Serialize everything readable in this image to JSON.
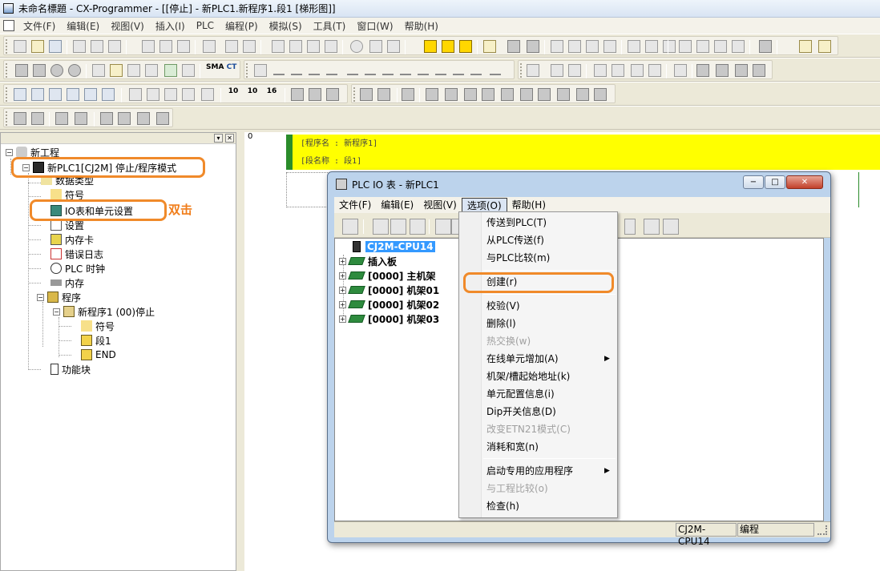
{
  "app": {
    "title": "未命名標題 - CX-Programmer - [[停止] - 新PLC1.新程序1.段1 [梯形图]]",
    "menu": [
      "文件(F)",
      "编辑(E)",
      "视图(V)",
      "插入(I)",
      "PLC",
      "编程(P)",
      "模拟(S)",
      "工具(T)",
      "窗口(W)",
      "帮助(H)"
    ]
  },
  "toolbar": {
    "row4_num_labels": [
      "10",
      "10",
      "16"
    ],
    "io_button": "I/O",
    "sma_label": "SMA",
    "ct_label": "CT"
  },
  "tree": {
    "root": "新工程",
    "plc": "新PLC1[CJ2M] 停止/程序模式",
    "datatype": "数据类型",
    "symbols": "符号",
    "io_table": "IO表和单元设置",
    "settings": "设置",
    "memcard": "内存卡",
    "errorlog": "错误日志",
    "clock": "PLC 时钟",
    "memory": "内存",
    "programs": "程序",
    "program1": "新程序1 (00)停止",
    "p_symbols": "符号",
    "p_section1": "段1",
    "p_end": "END",
    "function_blocks": "功能块"
  },
  "annotation": {
    "double_click": "双击"
  },
  "ladder": {
    "rung_number": "0",
    "program_name_line": "[程序名 : 新程序1]",
    "section_name_line": "[段名称 : 段1]"
  },
  "io_window": {
    "title": "PLC IO 表 - 新PLC1",
    "menu": [
      "文件(F)",
      "编辑(E)",
      "视图(V)",
      "选项(O)",
      "帮助(H)"
    ],
    "active_menu_index": 3,
    "tree": {
      "cpu": "CJ2M-CPU14",
      "items": [
        "插入板",
        "[0000] 主机架",
        "[0000] 机架01",
        "[0000] 机架02",
        "[0000] 机架03"
      ]
    },
    "status": {
      "cpu": "CJ2M-CPU14",
      "mode": "编程"
    },
    "options_menu": [
      {
        "label": "传送到PLC(T)",
        "enabled": true
      },
      {
        "label": "从PLC传送(f)",
        "enabled": true
      },
      {
        "label": "与PLC比较(m)",
        "enabled": true
      },
      {
        "label": "创建(r)",
        "enabled": true,
        "highlighted": true
      },
      {
        "label": "校验(V)",
        "enabled": true
      },
      {
        "label": "删除(l)",
        "enabled": true
      },
      {
        "label": "热交换(w)",
        "enabled": false
      },
      {
        "label": "在线单元增加(A)",
        "enabled": true,
        "submenu": true
      },
      {
        "label": "机架/槽起始地址(k)",
        "enabled": true
      },
      {
        "label": "单元配置信息(i)",
        "enabled": true
      },
      {
        "label": "Dip开关信息(D)",
        "enabled": true
      },
      {
        "label": "改变ETN21模式(C)",
        "enabled": false
      },
      {
        "label": "消耗和宽(n)",
        "enabled": true
      },
      {
        "label": "启动专用的应用程序",
        "enabled": true,
        "submenu": true
      },
      {
        "label": "与工程比较(o)",
        "enabled": false
      },
      {
        "label": "检查(h)",
        "enabled": true
      }
    ]
  },
  "colors": {
    "highlight_outline": "#f08a2a",
    "annotation_text": "#f07d1a",
    "ladder_header": "#ffff00",
    "rack_green": "#2e8b3e"
  }
}
